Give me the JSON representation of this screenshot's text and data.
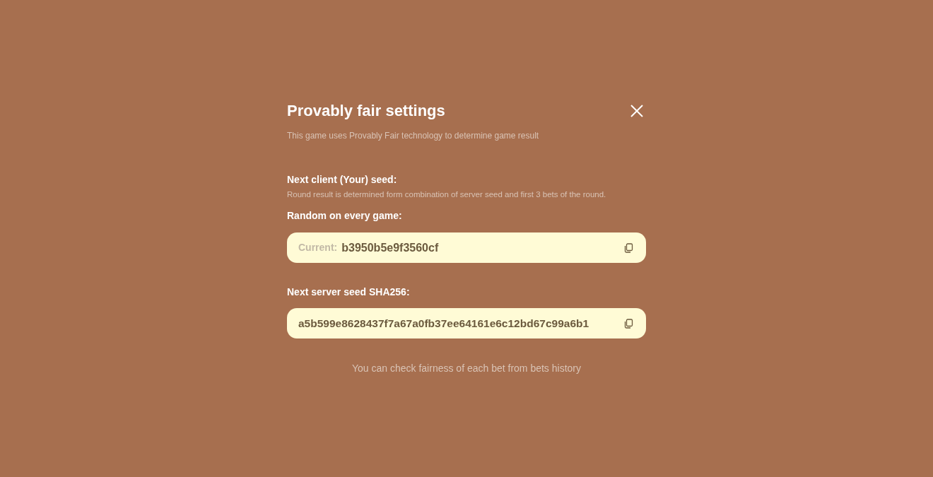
{
  "dialog": {
    "title": "Provably fair settings",
    "subtitle": "This game uses Provably Fair technology to determine game result"
  },
  "client_seed": {
    "heading": "Next client (Your) seed:",
    "description": "Round result is determined form combination of server seed and first 3 bets of the round.",
    "mode_label": "Random on every game:",
    "field_label": "Current:",
    "value": "b3950b5e9f3560cf"
  },
  "server_seed": {
    "heading": "Next server seed SHA256:",
    "value": "a5b599e8628437f7a67a0fb37ee64161e6c12bd67c99a6b1"
  },
  "footer_note": "You can check fairness of each bet from bets history"
}
